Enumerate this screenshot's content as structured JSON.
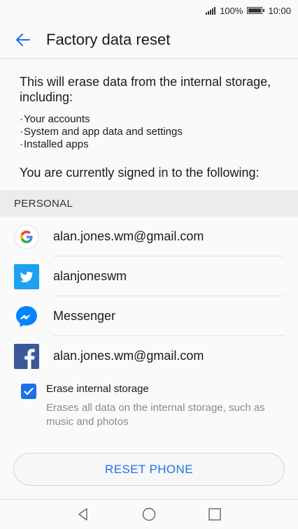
{
  "status_bar": {
    "battery_text": "100%",
    "time": "10:00"
  },
  "header": {
    "title": "Factory data reset",
    "back_icon": "arrow-left-icon"
  },
  "content": {
    "intro": "This will erase data from the internal storage, including:",
    "bullets": [
      "Your accounts",
      "System and app data and settings",
      "Installed apps"
    ],
    "signed_in_text": "You are currently signed in to the following:"
  },
  "section": {
    "label": "PERSONAL"
  },
  "accounts": [
    {
      "icon": "google-icon",
      "name": "alan.jones.wm@gmail.com"
    },
    {
      "icon": "twitter-icon",
      "name": "alanjoneswm"
    },
    {
      "icon": "messenger-icon",
      "name": "Messenger"
    },
    {
      "icon": "facebook-icon",
      "name": "alan.jones.wm@gmail.com"
    }
  ],
  "erase_option": {
    "checked": true,
    "title": "Erase internal storage",
    "description": "Erases all data on the internal storage, such as music and photos"
  },
  "reset_button": {
    "label": "RESET PHONE"
  },
  "colors": {
    "accent": "#1a73e8",
    "twitter": "#1da1f2",
    "facebook": "#3b5998",
    "messenger": "#0084ff"
  }
}
